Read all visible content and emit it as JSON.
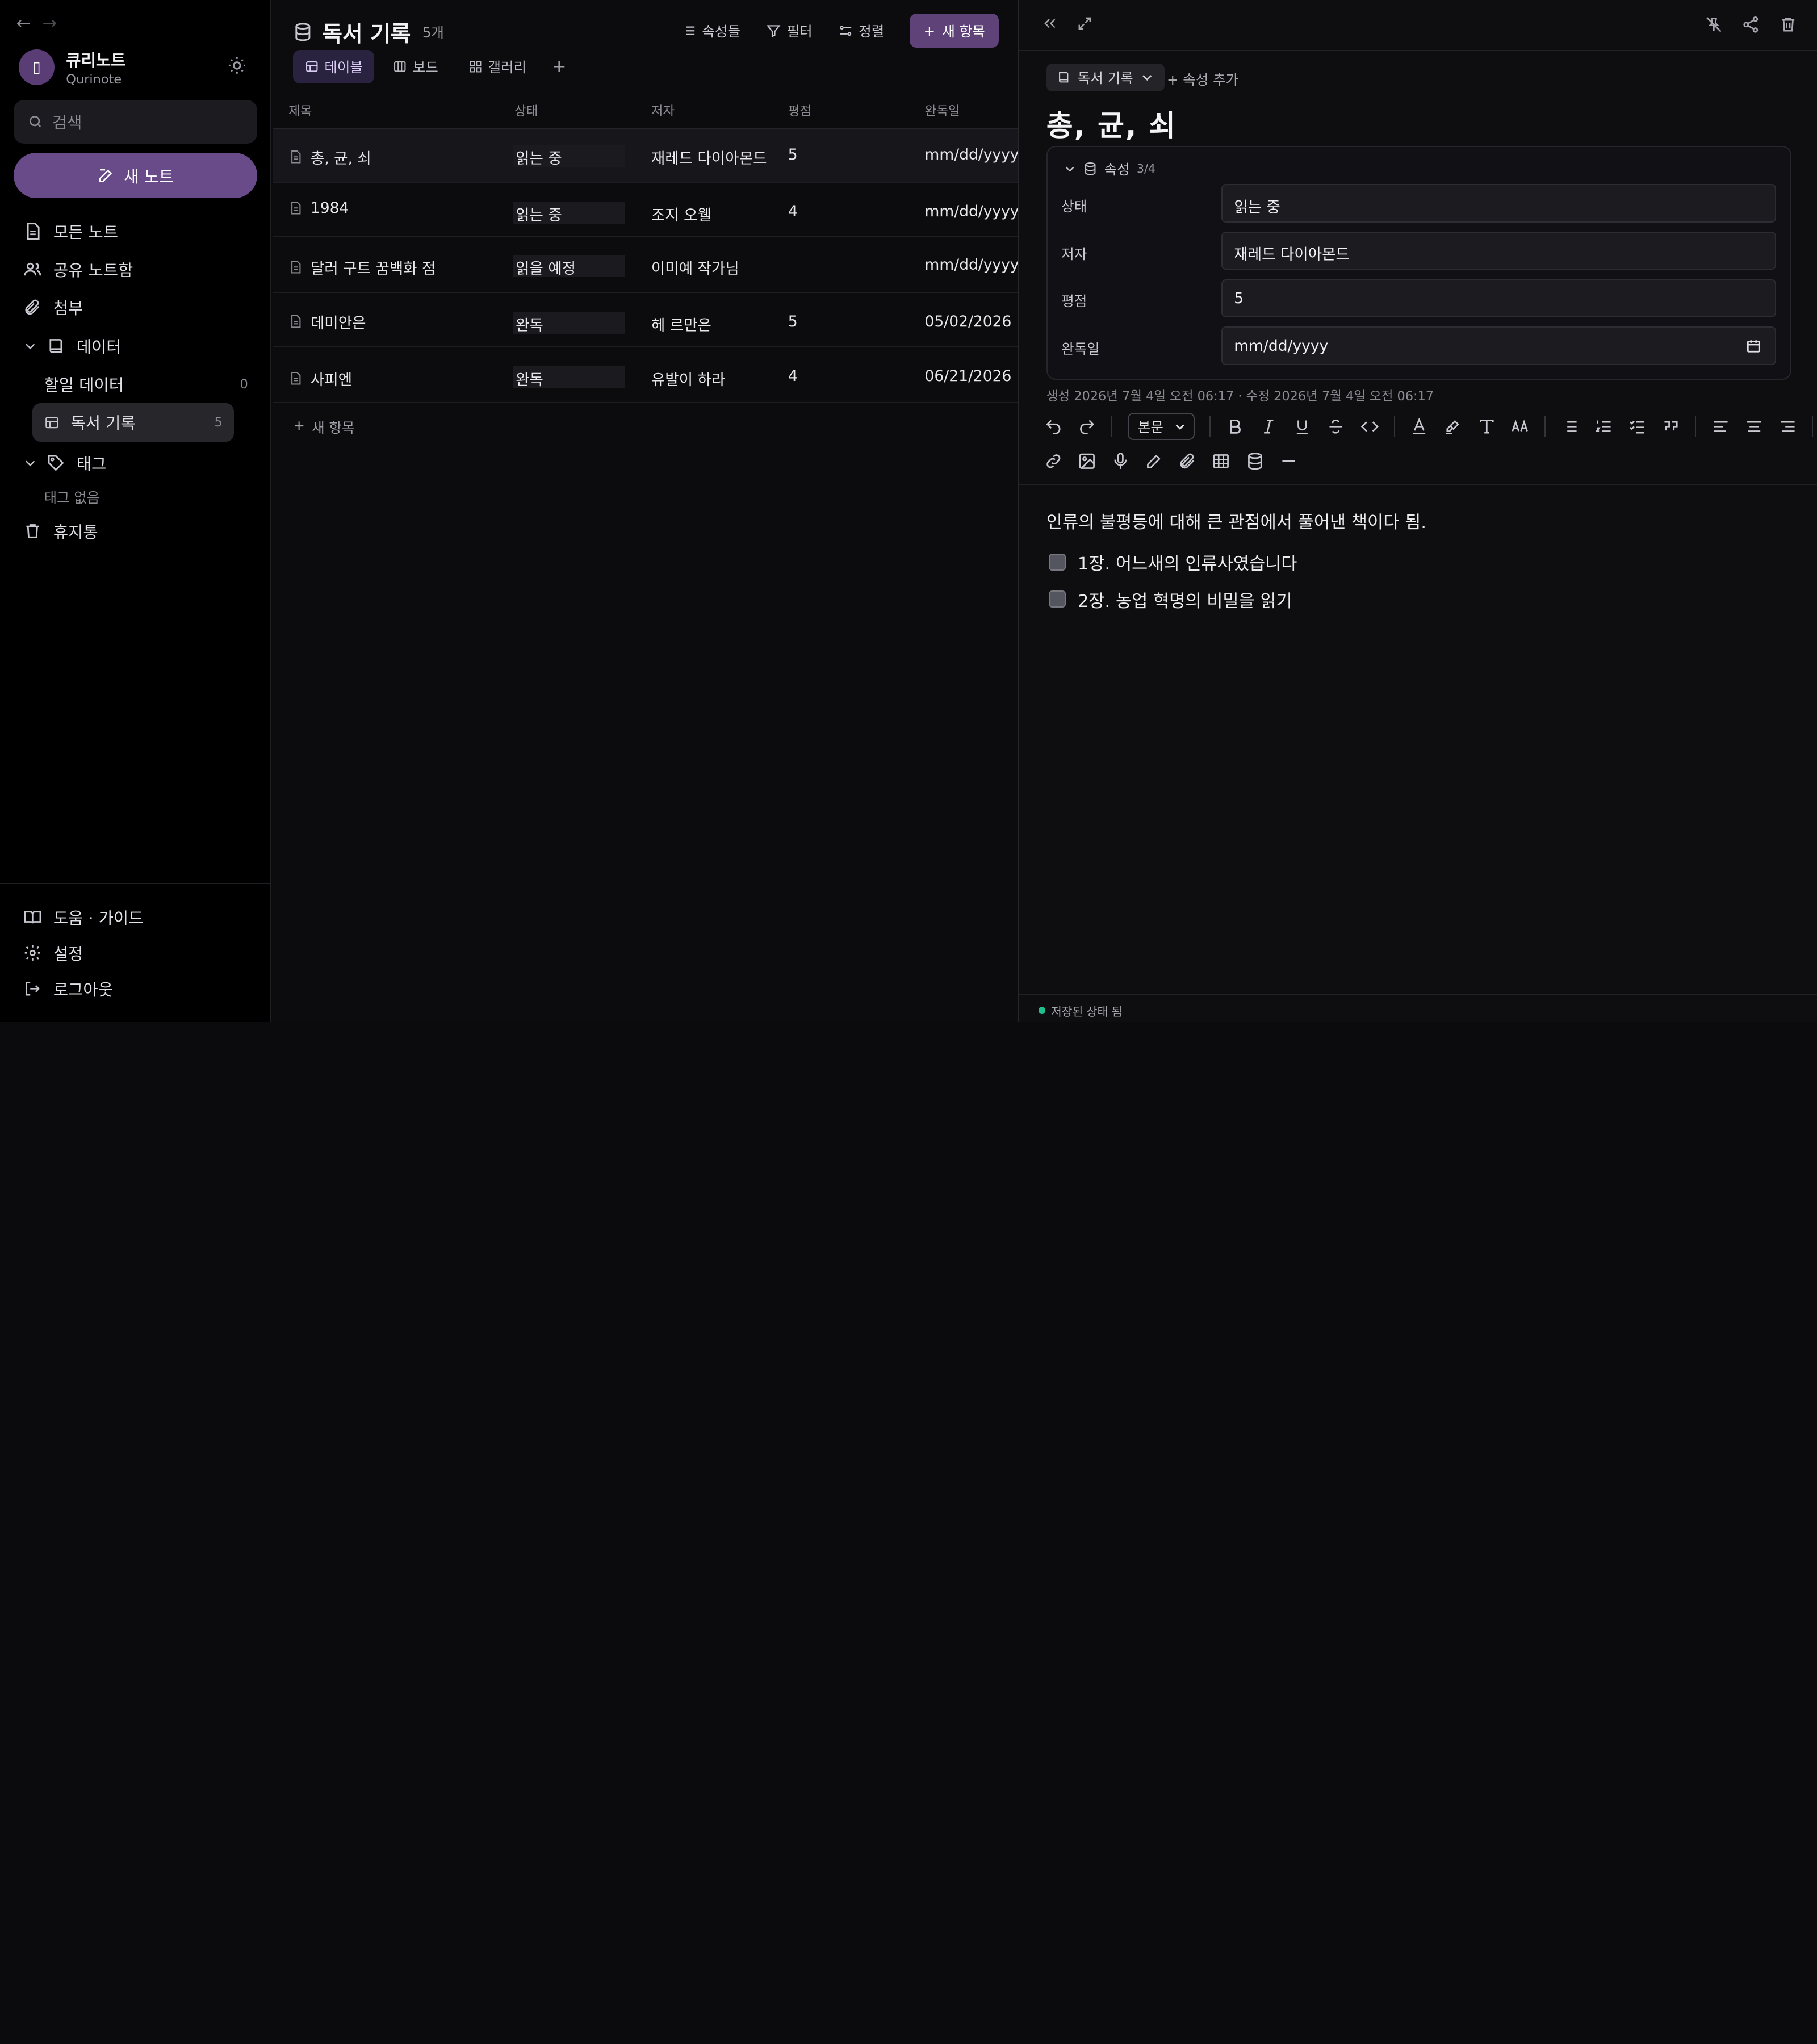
{
  "sidebar": {
    "workspace_name": "큐리노트",
    "workspace_sub": "Qurinote",
    "search_placeholder": "검색",
    "new_note_label": "새 노트",
    "items": [
      {
        "label": "모든 노트"
      },
      {
        "label": "공유 노트함"
      },
      {
        "label": "첨부"
      },
      {
        "label": "데이터"
      },
      {
        "label": "할일 데이터",
        "count": "0"
      },
      {
        "label": "독서 기록",
        "count": "5"
      },
      {
        "label": "태그"
      }
    ],
    "tags_empty": "태그 없음",
    "trash_label": "휴지통",
    "bottom": [
      {
        "label": "도움 · 가이드"
      },
      {
        "label": "설정"
      },
      {
        "label": "로그아웃"
      }
    ]
  },
  "main": {
    "title": "독서 기록",
    "count": "5개",
    "toolbar": {
      "properties": "속성들",
      "filter": "필터",
      "sort": "정렬",
      "new": "새 항목"
    },
    "tabs": [
      {
        "label": "테이블"
      },
      {
        "label": "보드"
      },
      {
        "label": "갤러리"
      }
    ],
    "add_tab": "+",
    "columns": [
      "제목",
      "상태",
      "저자",
      "평점",
      "완독일"
    ],
    "rows": [
      {
        "title": "총, 균, 쇠",
        "status": "읽는 중",
        "author": "재레드 다이아몬드",
        "rating": "5",
        "date": "mm/dd/yyyy"
      },
      {
        "title": "1984",
        "status": "읽는 중",
        "author": "조지 오웰",
        "rating": "4",
        "date": "mm/dd/yyyy"
      },
      {
        "title": "달러 구트 꿈백화 점",
        "status": "읽을 예정",
        "author": "이미예 작가님",
        "rating": "",
        "date": "mm/dd/yyyy"
      },
      {
        "title": "데미안은",
        "status": "완독",
        "author": "헤 르만은",
        "rating": "5",
        "date": "05/02/2026"
      },
      {
        "title": "사피엔",
        "status": "완독",
        "author": "유발이 하라",
        "rating": "4",
        "date": "06/21/2026"
      }
    ],
    "add_row": "새 항목"
  },
  "panel": {
    "type_label": "독서 기록",
    "add_property": "+ 속성 추가",
    "note_title": "총, 균, 쇠",
    "props_header": "속성",
    "props_fraction": "3/4",
    "props": [
      {
        "label": "상태",
        "value": "읽는 중"
      },
      {
        "label": "저자",
        "value": "재레드 다이아몬드"
      },
      {
        "label": "평점",
        "value": "5"
      },
      {
        "label": "완독일",
        "value": "mm/dd/yyyy"
      }
    ],
    "meta": "생성 2026년 7월 4일 오전 06:17 · 수정 2026년 7월 4일 오전 06:17",
    "font_select": "본문",
    "body_text": "인류의 불평등에 대해 큰 관점에서 풀어낸 책이다 됨.",
    "tasks": [
      {
        "label": "1장. 어느새의 인류사였습니다"
      },
      {
        "label": "2장. 농업 혁명의 비밀을 읽기"
      }
    ],
    "status_text": "저장된 상태 됨"
  },
  "colors": {
    "accent": "#6a4b8a",
    "accent_dark": "#5e4278",
    "status_green": "#1fbf8f",
    "bg": "#0c0c0f"
  }
}
